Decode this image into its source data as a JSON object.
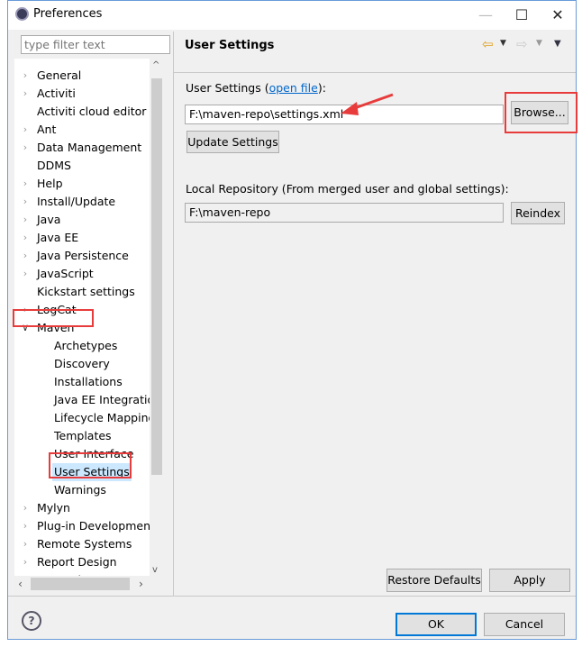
{
  "window": {
    "title": "Preferences",
    "icon": "eclipse-icon"
  },
  "filter": {
    "placeholder": "type filter text"
  },
  "tree": [
    {
      "label": "General",
      "expand": "collapsed"
    },
    {
      "label": "Activiti",
      "expand": "collapsed"
    },
    {
      "label": "Activiti cloud editor",
      "expand": "none"
    },
    {
      "label": "Ant",
      "expand": "collapsed"
    },
    {
      "label": "Data Management",
      "expand": "collapsed"
    },
    {
      "label": "DDMS",
      "expand": "none"
    },
    {
      "label": "Help",
      "expand": "collapsed"
    },
    {
      "label": "Install/Update",
      "expand": "collapsed"
    },
    {
      "label": "Java",
      "expand": "collapsed"
    },
    {
      "label": "Java EE",
      "expand": "collapsed"
    },
    {
      "label": "Java Persistence",
      "expand": "collapsed"
    },
    {
      "label": "JavaScript",
      "expand": "collapsed"
    },
    {
      "label": "Kickstart settings",
      "expand": "none"
    },
    {
      "label": "LogCat",
      "expand": "collapsed"
    },
    {
      "label": "Maven",
      "expand": "expanded",
      "highlight": true
    },
    {
      "label": "Archetypes",
      "child": true
    },
    {
      "label": "Discovery",
      "child": true
    },
    {
      "label": "Installations",
      "child": true
    },
    {
      "label": "Java EE Integration",
      "child": true
    },
    {
      "label": "Lifecycle Mappings",
      "child": true
    },
    {
      "label": "Templates",
      "child": true
    },
    {
      "label": "User Interface",
      "child": true
    },
    {
      "label": "User Settings",
      "child": true,
      "selected": true,
      "highlight": true
    },
    {
      "label": "Warnings",
      "child": true
    },
    {
      "label": "Mylyn",
      "expand": "collapsed"
    },
    {
      "label": "Plug-in Development",
      "expand": "collapsed"
    },
    {
      "label": "Remote Systems",
      "expand": "collapsed"
    },
    {
      "label": "Report Design",
      "expand": "collapsed"
    },
    {
      "label": "Run/Debug",
      "expand": "collapsed"
    }
  ],
  "page": {
    "title": "User Settings",
    "user_settings_label": "User Settings (",
    "open_file_link": "open file",
    "user_settings_label_end": "):",
    "user_settings_value": "F:\\maven-repo\\settings.xml",
    "browse_label": "Browse...",
    "update_label": "Update Settings",
    "local_repo_label": "Local Repository (From merged user and global settings):",
    "local_repo_value": "F:\\maven-repo",
    "reindex_label": "Reindex",
    "restore_label": "Restore Defaults",
    "apply_label": "Apply"
  },
  "footer": {
    "ok_label": "OK",
    "cancel_label": "Cancel"
  },
  "colors": {
    "annotation": "#e83c3c",
    "selection": "#cce8ff",
    "link": "#0066cc"
  }
}
